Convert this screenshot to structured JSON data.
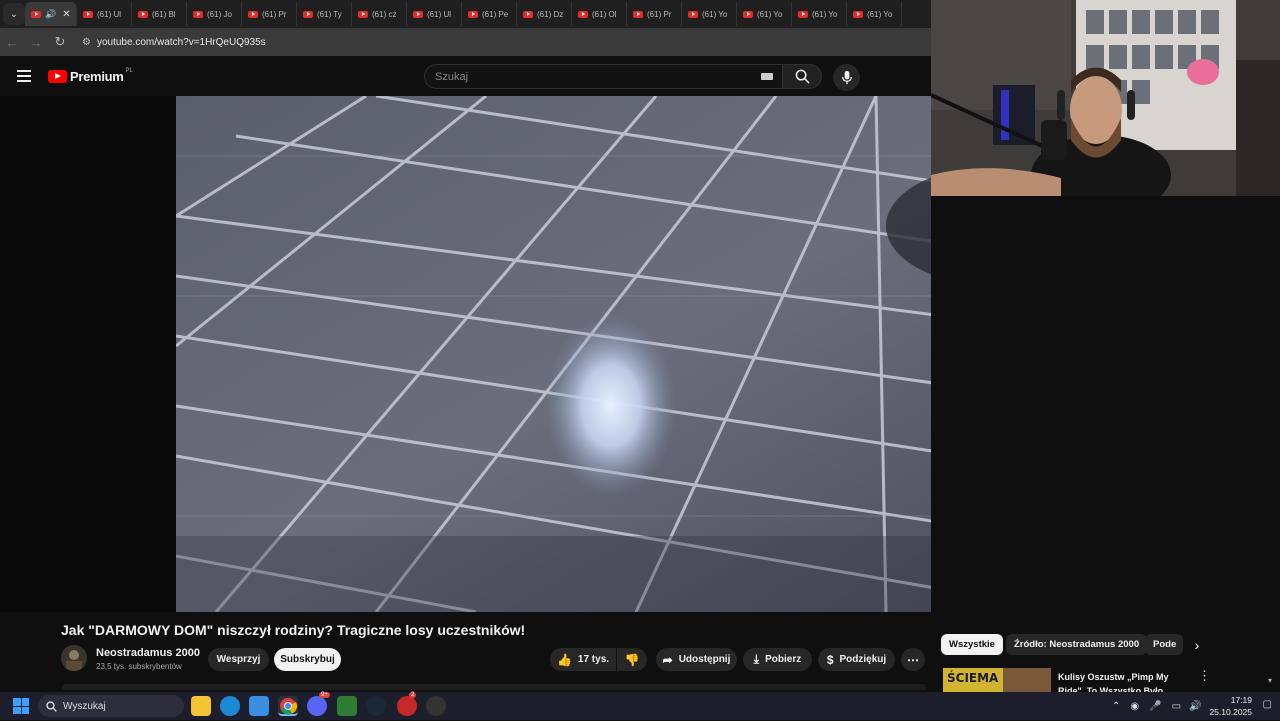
{
  "browser": {
    "tabs": [
      {
        "label": ""
      },
      {
        "label": "(61) Ul"
      },
      {
        "label": "(61) Bl"
      },
      {
        "label": "(61) Jo"
      },
      {
        "label": "(61) Pr"
      },
      {
        "label": "(61) Ty"
      },
      {
        "label": "(61) cz"
      },
      {
        "label": "(61) Ul"
      },
      {
        "label": "(61) Pe"
      },
      {
        "label": "(61) Dz"
      },
      {
        "label": "(61) Ol"
      },
      {
        "label": "(61) Pr"
      },
      {
        "label": "(61) Yo"
      },
      {
        "label": "(61) Yo"
      },
      {
        "label": "(61) Yo"
      },
      {
        "label": "(61) Yo"
      }
    ],
    "url": "youtube.com/watch?v=1HrQeUQ935s"
  },
  "header": {
    "logo_text": "Premium",
    "logo_region": "PL",
    "search_placeholder": "Szukaj"
  },
  "video": {
    "title": "Jak \"DARMOWY DOM\" niszczył rodziny? Tragiczne losy uczestników!",
    "channel": "Neostradamus 2000",
    "subscribers": "23,5 tys. subskrybentów",
    "support_label": "Wesprzyj",
    "subscribe_label": "Subskrybuj",
    "likes": "17 tys.",
    "share_label": "Udostępnij",
    "download_label": "Pobierz",
    "thanks_label": "Podziękuj"
  },
  "sidebar": {
    "chips": [
      {
        "label": "Wszystkie"
      },
      {
        "label": "Źródło: Neostradamus 2000"
      },
      {
        "label": "Pode"
      }
    ],
    "recommendation": {
      "title": "Kulisy Oszustw „Pimp My Ride\". To Wszystko Było Ustawione!",
      "thumb_text": "ŚCIEMA"
    }
  },
  "taskbar": {
    "search_placeholder": "Wyszukaj",
    "time": "17:19",
    "date": "25.10.2025",
    "discord_badge": "9+",
    "app_badge": "2"
  },
  "colors": {
    "youtube_red": "#ff0000",
    "background": "#0f0f0f",
    "chip_bg": "#272727",
    "taskbar": "#1c1f2b"
  }
}
